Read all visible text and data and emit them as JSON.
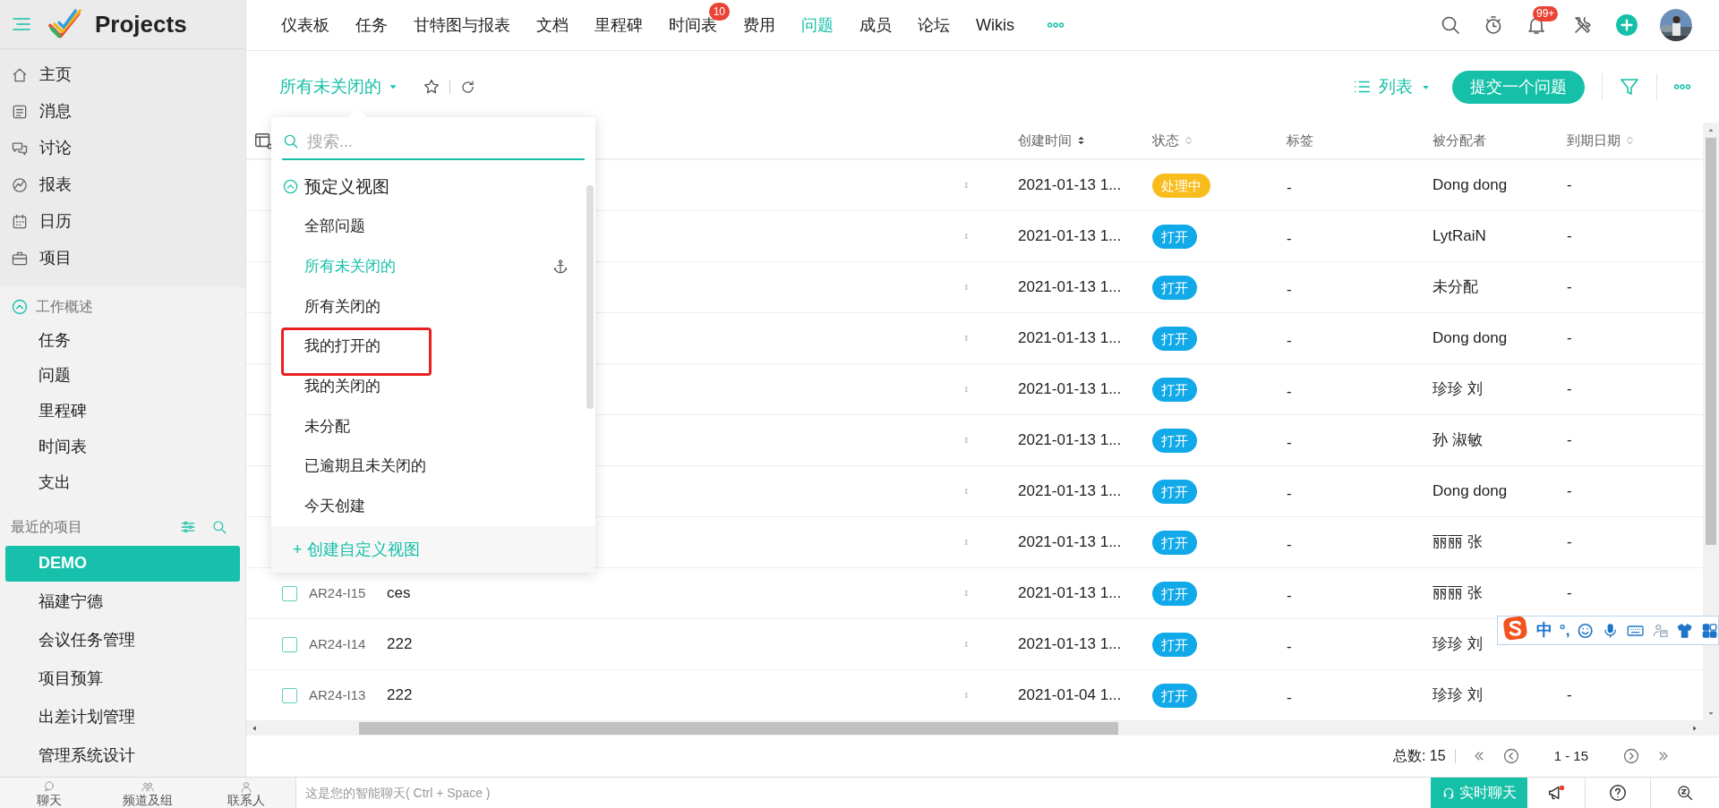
{
  "app": {
    "name": "Projects"
  },
  "sidebar": {
    "nav": [
      {
        "label": "主页",
        "selected": false
      },
      {
        "label": "消息",
        "selected": false
      },
      {
        "label": "讨论",
        "selected": false
      },
      {
        "label": "报表",
        "selected": false
      },
      {
        "label": "日历",
        "selected": false
      },
      {
        "label": "项目",
        "selected": false
      }
    ],
    "work_overview": {
      "title": "工作概述",
      "expanded": true,
      "items": [
        "任务",
        "问题",
        "里程碑",
        "时间表",
        "支出"
      ]
    },
    "recent_projects": {
      "title": "最近的项目",
      "items": [
        {
          "label": "DEMO",
          "selected": true
        },
        {
          "label": "福建宁德",
          "selected": false
        },
        {
          "label": "会议任务管理",
          "selected": false
        },
        {
          "label": "项目预算",
          "selected": false
        },
        {
          "label": "出差计划管理",
          "selected": false
        },
        {
          "label": "管理系统设计",
          "selected": false
        }
      ]
    }
  },
  "top_nav": [
    {
      "label": "仪表板",
      "selected": false
    },
    {
      "label": "任务",
      "selected": false
    },
    {
      "label": "甘特图与报表",
      "selected": false
    },
    {
      "label": "文档",
      "selected": false
    },
    {
      "label": "里程碑",
      "selected": false
    },
    {
      "label": "时间表",
      "selected": false,
      "badge": "10"
    },
    {
      "label": "费用",
      "selected": false
    },
    {
      "label": "问题",
      "selected": true
    },
    {
      "label": "成员",
      "selected": false
    },
    {
      "label": "论坛",
      "selected": false
    },
    {
      "label": "Wikis",
      "selected": false
    }
  ],
  "notifications_badge": "99+",
  "toolbar": {
    "view": "所有未关闭的",
    "layout": "列表",
    "submit_button": "提交一个问题"
  },
  "table": {
    "columns": [
      {
        "label": "创建时间",
        "sortable": true,
        "sorted": true
      },
      {
        "label": "状态",
        "sortable": true,
        "sorted": false
      },
      {
        "label": "标签",
        "sortable": false
      },
      {
        "label": "被分配者",
        "sortable": false
      },
      {
        "label": "到期日期",
        "sortable": true,
        "sorted": false
      }
    ],
    "rows": [
      {
        "created": "2021-01-13 1...",
        "status": {
          "label": "处理中",
          "color": "#f8bd1c"
        },
        "tag": "-",
        "assignee": "Dong dong",
        "due": "-"
      },
      {
        "created": "2021-01-13 1...",
        "status": {
          "label": "打开",
          "color": "#11a9e8"
        },
        "tag": "-",
        "assignee": "LytRaiN",
        "due": "-"
      },
      {
        "created": "2021-01-13 1...",
        "status": {
          "label": "打开",
          "color": "#11a9e8"
        },
        "tag": "-",
        "assignee": "未分配",
        "due": "-"
      },
      {
        "created": "2021-01-13 1...",
        "status": {
          "label": "打开",
          "color": "#11a9e8"
        },
        "tag": "-",
        "assignee": "Dong dong",
        "due": "-"
      },
      {
        "created": "2021-01-13 1...",
        "status": {
          "label": "打开",
          "color": "#11a9e8"
        },
        "tag": "-",
        "assignee": "珍珍 刘",
        "due": "-"
      },
      {
        "created": "2021-01-13 1...",
        "status": {
          "label": "打开",
          "color": "#11a9e8"
        },
        "tag": "-",
        "assignee": "孙 淑敏",
        "due": "-"
      },
      {
        "created": "2021-01-13 1...",
        "status": {
          "label": "打开",
          "color": "#11a9e8"
        },
        "tag": "-",
        "assignee": "Dong dong",
        "due": "-"
      },
      {
        "created": "2021-01-13 1...",
        "status": {
          "label": "打开",
          "color": "#11a9e8"
        },
        "tag": "-",
        "assignee": "丽丽 张",
        "due": "-"
      },
      {
        "id": "AR24-I15",
        "title": "ces",
        "checked": false,
        "created": "2021-01-13 1...",
        "status": {
          "label": "打开",
          "color": "#11a9e8"
        },
        "tag": "-",
        "assignee": "丽丽 张",
        "due": "-"
      },
      {
        "id": "AR24-I14",
        "title": "222",
        "checked": false,
        "created": "2021-01-13 1...",
        "status": {
          "label": "打开",
          "color": "#11a9e8"
        },
        "tag": "-",
        "assignee": "珍珍 刘"
      },
      {
        "id": "AR24-I13",
        "title": "222",
        "checked": false,
        "created": "2021-01-04 1...",
        "status": {
          "label": "打开",
          "color": "#11a9e8"
        },
        "tag": "-",
        "assignee": "珍珍 刘",
        "due": "-"
      }
    ]
  },
  "view_dropdown": {
    "search_placeholder": "搜索...",
    "section": {
      "title": "预定义视图",
      "expanded": true
    },
    "items": [
      {
        "label": "全部问题",
        "selected": false,
        "pinned": false,
        "highlighted": false
      },
      {
        "label": "所有未关闭的",
        "selected": true,
        "pinned": true,
        "highlighted": false
      },
      {
        "label": "所有关闭的",
        "selected": false,
        "pinned": false,
        "highlighted": false
      },
      {
        "label": "我的打开的",
        "selected": false,
        "pinned": false,
        "highlighted": true
      },
      {
        "label": "我的关闭的",
        "selected": false,
        "pinned": false,
        "highlighted": false
      },
      {
        "label": "未分配",
        "selected": false,
        "pinned": false,
        "highlighted": false
      },
      {
        "label": "已逾期且未关闭的",
        "selected": false,
        "pinned": false,
        "highlighted": false
      },
      {
        "label": "今天创建",
        "selected": false,
        "pinned": false,
        "highlighted": false
      }
    ],
    "create_link": "+ 创建自定义视图"
  },
  "pagination": {
    "total": "总数: 15",
    "range": "1 - 15"
  },
  "chat_bar": {
    "tabs": [
      "聊天",
      "频道及组",
      "联系人"
    ],
    "placeholder": "这是您的智能聊天( Ctrl + Space )",
    "live_button": "实时聊天"
  },
  "ime_toolbar": {
    "mode": "中",
    "punctuation": "°,"
  }
}
